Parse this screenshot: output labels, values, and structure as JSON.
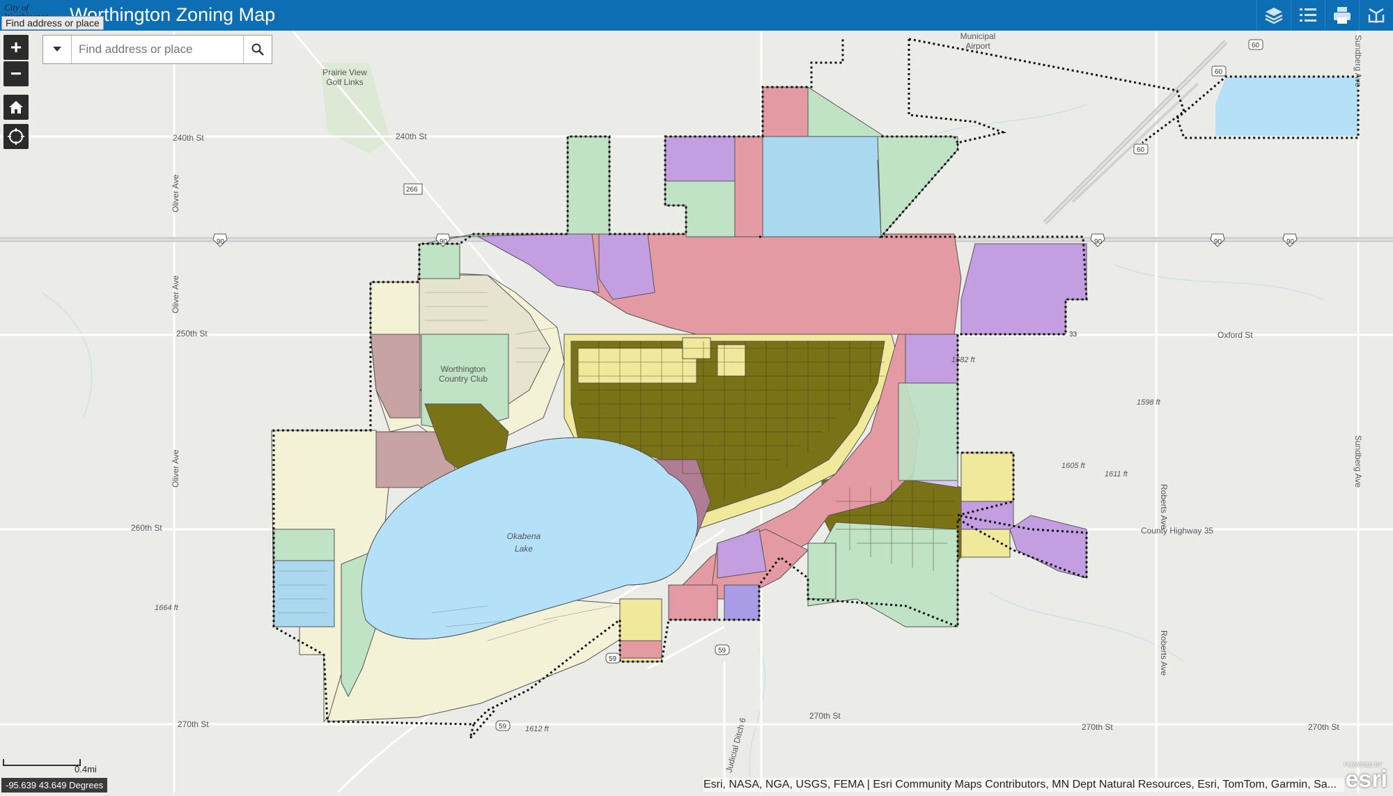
{
  "app": {
    "title": "Worthington Zoning Map",
    "logo_text": "City of Worthington",
    "tooltip": "Find address or place"
  },
  "toolbar": {
    "tools": [
      {
        "name": "layers-icon"
      },
      {
        "name": "legend-icon"
      },
      {
        "name": "print-icon"
      },
      {
        "name": "share-icon"
      }
    ]
  },
  "search": {
    "placeholder": "Find address or place"
  },
  "zoom": {
    "in_label": "+",
    "out_label": "−"
  },
  "map": {
    "road_labels": {
      "r240_w": "240th St",
      "r240_c": "240th St",
      "r250_w": "250th St",
      "oxford_e": "Oxford St",
      "r260_w": "260th St",
      "cty35": "County Highway 35",
      "r270_w": "270th St",
      "r270_c": "270th St",
      "r270_e1": "270th St",
      "r270_e2": "270th St",
      "oliver1": "Oliver Ave",
      "oliver2": "Oliver Ave",
      "oliver3": "Oliver Ave",
      "roberts1": "Roberts Ave",
      "roberts2": "Roberts Ave",
      "sundberg1": "Sundberg Ave",
      "sundberg2": "Sundberg Ave",
      "judicial": "Judicial Ditch 6"
    },
    "place_labels": {
      "airport1": "Municipal",
      "airport2": "Airport",
      "golf1": "Prairie View",
      "golf2": "Golf Links",
      "club1": "Worthington",
      "club2": "Country Club",
      "lake1": "Okabena",
      "lake2": "Lake"
    },
    "elevations": {
      "e1664": "1664 ft",
      "e1612": "1612 ft",
      "e1598": "1598 ft",
      "e1605": "1605 ft",
      "e1611": "1611 ft",
      "e1582": "1582 ft"
    },
    "shields": {
      "i90": "90",
      "us59": "59",
      "us60": "60",
      "cr266": "266",
      "hwy33": "33"
    },
    "zone_colors": {
      "residential_single": "#7a7217",
      "residential_light": "#f0e89a",
      "commercial": "#e39aa2",
      "industrial": "#c39ee0",
      "agriculture": "#bfe3c4",
      "lake": "#b5e1f8",
      "institutional": "#a9d8ef",
      "rural": "#f3f1d6",
      "planned": "#c7a3a3"
    }
  },
  "scale": {
    "label": "0.4mi"
  },
  "coords": {
    "text": "-95.639 43.649 Degrees"
  },
  "attribution": {
    "text": "Esri, NASA, NGA, USGS, FEMA | Esri Community Maps Contributors, MN Dept Natural Resources, Esri, TomTom, Garmin, Sa..."
  },
  "branding": {
    "powered": "POWERED BY",
    "esri": "esri"
  }
}
